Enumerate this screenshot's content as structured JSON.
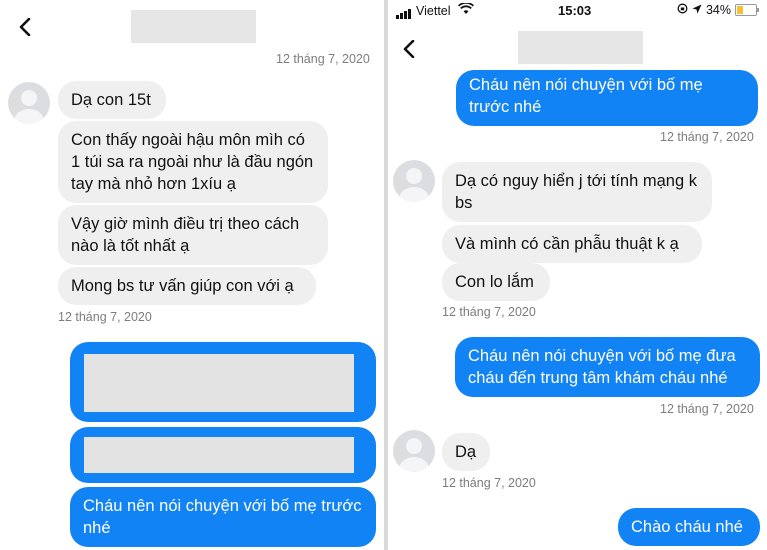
{
  "left": {
    "timestamps": [
      "12 tháng 7, 2020",
      "12 tháng 7, 2020"
    ],
    "incoming": [
      "Dạ con 15t",
      "Con thấy ngoài hậu môn mìh có 1 túi sa ra ngoài như là đầu ngón tay mà nhỏ hơn 1xíu ạ",
      "Vậy giờ mình điều trị theo cách nào là tốt nhất ạ",
      "Mong bs tư vấn giúp con với ạ"
    ],
    "outgoing": [
      "Cháu nên nói chuyện với bố mẹ trước nhé"
    ]
  },
  "right": {
    "status": {
      "carrier": "Viettel",
      "time": "15:03",
      "battery": "34%",
      "battery_level": 0.34
    },
    "timestamps": [
      "12 tháng 7, 2020",
      "12 tháng 7, 2020",
      "12 tháng 7, 2020",
      "12 tháng 7, 2020"
    ],
    "incoming": [
      "Dạ có nguy hiển j tới tính mạng k bs",
      "Và mình có cần phẫu thuật k ạ",
      "Con lo lắm",
      "Dạ"
    ],
    "outgoing": [
      "Cháu nên nói chuyện với bố mẹ trước nhé",
      "Cháu nên nói chuyện với bố mẹ đưa cháu đến trung tâm khám cháu nhé",
      "Chào cháu nhé"
    ]
  },
  "colors": {
    "outgoing_bubble": "#1183f5",
    "incoming_bubble": "#efefef",
    "timestamp": "#7d7d7d"
  },
  "icons": [
    "back-arrow-icon",
    "avatar-icon",
    "signal-icon",
    "wifi-icon",
    "location-icon",
    "battery-icon"
  ]
}
